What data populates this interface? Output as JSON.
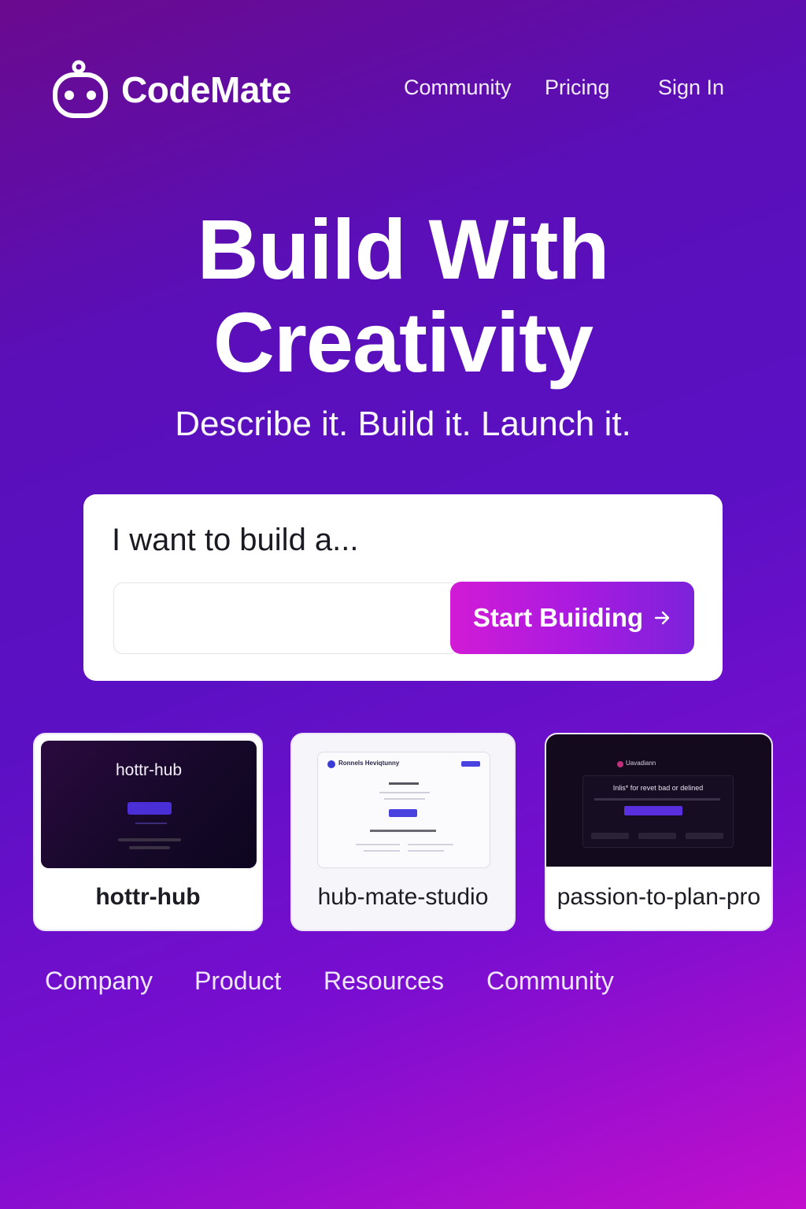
{
  "brand": {
    "name": "CodeMate",
    "logo_icon": "robot-face-icon"
  },
  "nav": {
    "items": [
      "Community",
      "Pricing",
      "Sign In"
    ]
  },
  "hero": {
    "title_line1": "Build With",
    "title_line2": "Creativity",
    "subtitle": "Describe it. Build it. Launch it."
  },
  "builder": {
    "label": "I want to build a...",
    "input_value": "",
    "button_label": "Start Buiiding",
    "button_icon": "arrow-right-icon"
  },
  "projects": [
    {
      "name": "hottr-hub",
      "thumb_title": "hottr-hub",
      "theme": "dark"
    },
    {
      "name": "hub-mate-studio",
      "thumb_title": "Ronnels Heviqtunny",
      "theme": "light"
    },
    {
      "name": "passion-to-plan-pro",
      "thumb_brand": "Uavadiann",
      "thumb_text": "Inlis* for revet bad or delined",
      "theme": "dark"
    }
  ],
  "footer": {
    "links": [
      "Company",
      "Product",
      "Resources",
      "Community"
    ]
  },
  "colors": {
    "accent_start": "#d21bd6",
    "accent_end": "#7c22db",
    "bg_purple": "#5b10c4",
    "bg_magenta": "#c20fcc"
  }
}
